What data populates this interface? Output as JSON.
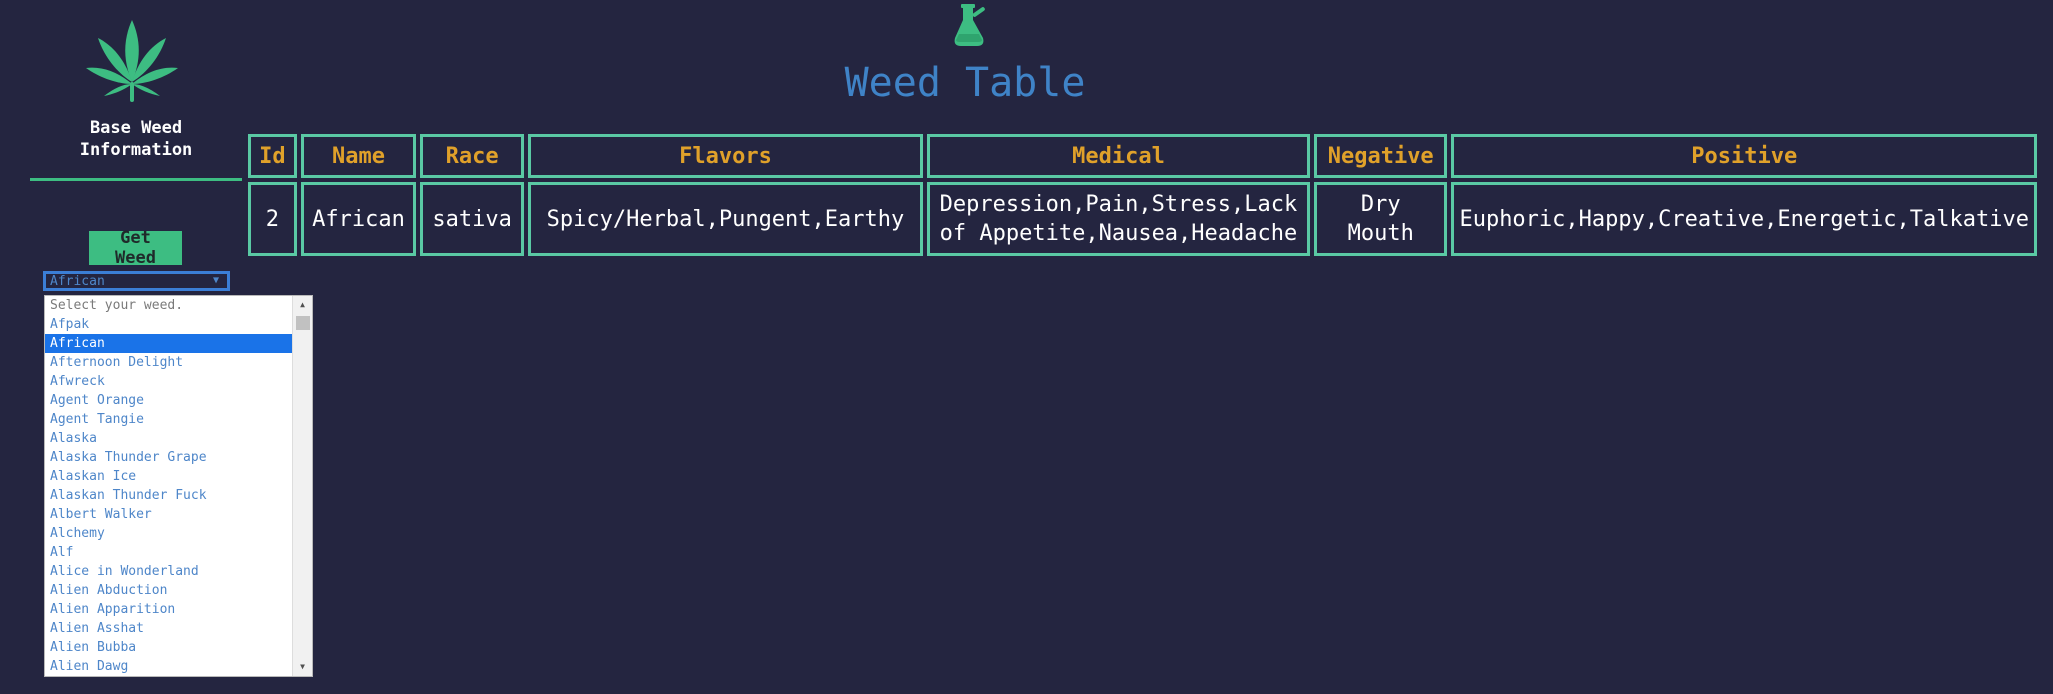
{
  "sidebar": {
    "title": "Base Weed\nInformation",
    "get_button_label": "Get Weed",
    "select": {
      "selected_value": "African",
      "options": [
        "Select your weed.",
        "Afpak",
        "African",
        "Afternoon Delight",
        "Afwreck",
        "Agent Orange",
        "Agent Tangie",
        "Alaska",
        "Alaska Thunder Grape",
        "Alaskan Ice",
        "Alaskan Thunder Fuck",
        "Albert Walker",
        "Alchemy",
        "Alf",
        "Alice in Wonderland",
        "Alien Abduction",
        "Alien Apparition",
        "Alien Asshat",
        "Alien Bubba",
        "Alien Dawg"
      ],
      "selected_index": 2
    }
  },
  "header": {
    "title": "Weed Table",
    "icon": "flask-icon"
  },
  "table": {
    "columns": [
      "Id",
      "Name",
      "Race",
      "Flavors",
      "Medical",
      "Negative",
      "Positive"
    ],
    "rows": [
      [
        "2",
        "African",
        "sativa",
        "Spicy/Herbal,Pungent,Earthy",
        "Depression,Pain,Stress,Lack of Appetite,Nausea,Headache",
        "Dry Mouth",
        "Euphoric,Happy,Creative,Energetic,Talkative"
      ]
    ]
  },
  "colors": {
    "background": "#242540",
    "accent_green": "#3dbd82",
    "title_blue": "#3f83c7",
    "header_orange": "#e0a12a",
    "table_border": "#5ac9a4",
    "select_blue": "#1a73e8"
  }
}
